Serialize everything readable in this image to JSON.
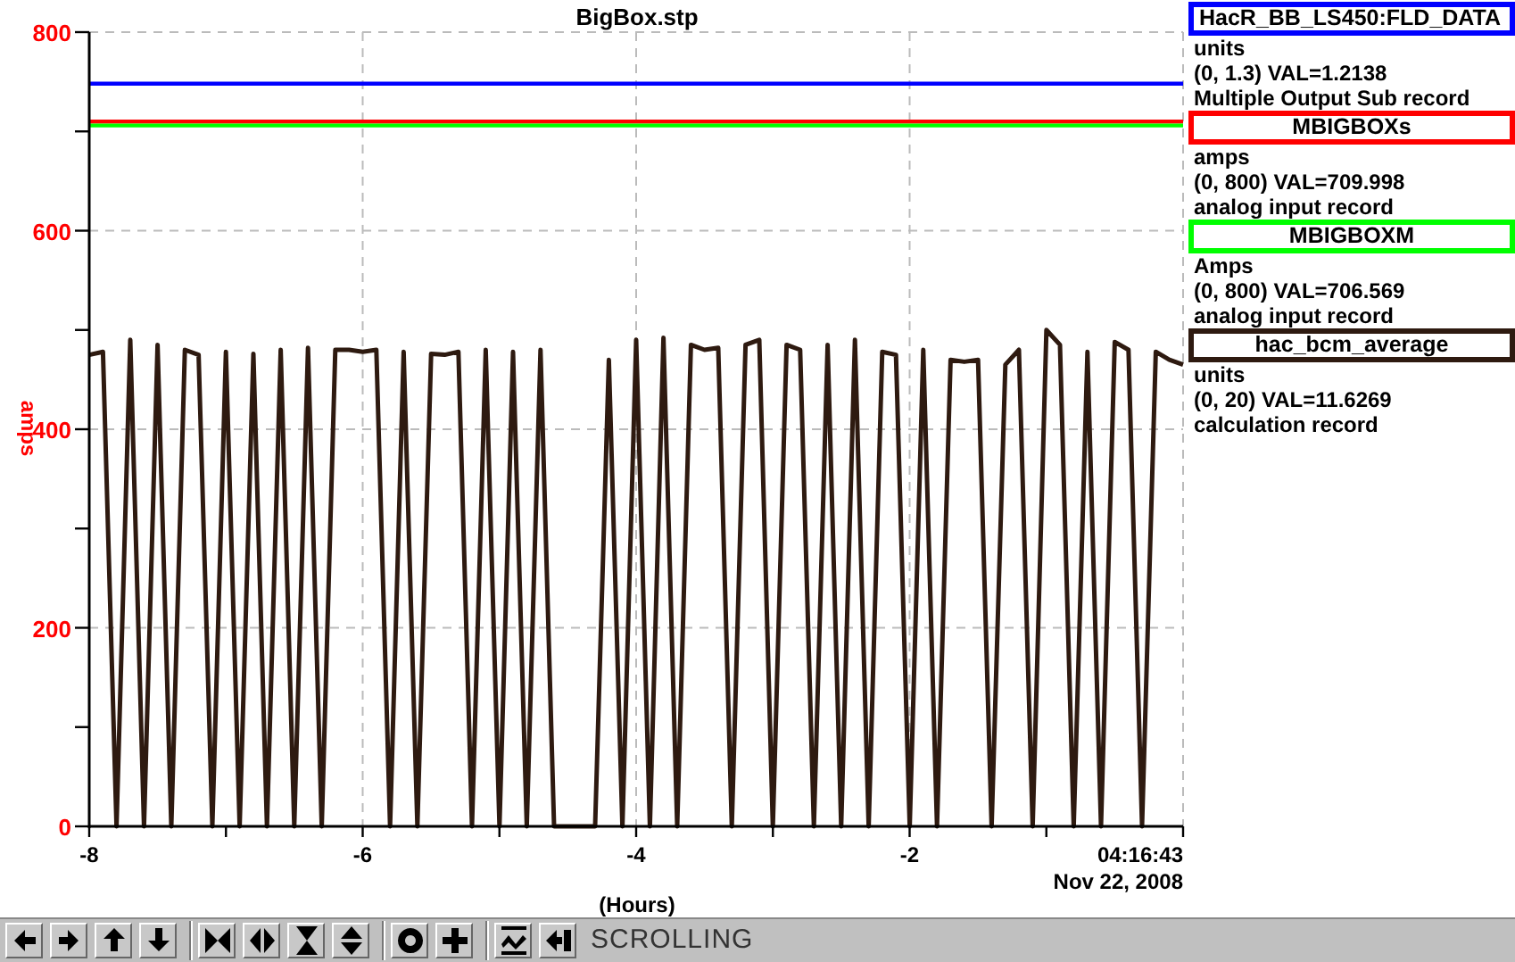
{
  "window": {
    "title": "BigBox.stp"
  },
  "chart": {
    "chart_data": {
      "type": "line",
      "grid": true,
      "xlabel": "(Hours)",
      "ylabel": "amps",
      "xlim": [
        -8,
        0
      ],
      "ylim": [
        0,
        800
      ],
      "xticks": [
        -8,
        -6,
        -4,
        -2
      ],
      "yticks": [
        0,
        200,
        400,
        600,
        800
      ],
      "x": [
        -8,
        -7.9,
        -7.8,
        -7.7,
        -7.6,
        -7.5,
        -7.4,
        -7.3,
        -7.2,
        -7.1,
        -7,
        -6.9,
        -6.8,
        -6.7,
        -6.6,
        -6.5,
        -6.4,
        -6.3,
        -6.2,
        -6.1,
        -6,
        -5.9,
        -5.8,
        -5.7,
        -5.6,
        -5.5,
        -5.4,
        -5.3,
        -5.2,
        -5.1,
        -5,
        -4.9,
        -4.8,
        -4.7,
        -4.6,
        -4.5,
        -4.4,
        -4.3,
        -4.2,
        -4.1,
        -4,
        -3.9,
        -3.8,
        -3.7,
        -3.6,
        -3.5,
        -3.4,
        -3.3,
        -3.2,
        -3.1,
        -3,
        -2.9,
        -2.8,
        -2.7,
        -2.6,
        -2.5,
        -2.4,
        -2.3,
        -2.2,
        -2.1,
        -2,
        -1.9,
        -1.8,
        -1.7,
        -1.6,
        -1.5,
        -1.4,
        -1.3,
        -1.2,
        -1.1,
        -1,
        -0.9,
        -0.8,
        -0.7,
        -0.6,
        -0.5,
        -0.4,
        -0.3,
        -0.2,
        -0.1,
        0
      ],
      "series": [
        {
          "name": "HacR_BB_LS450:FLD_DATA",
          "color": "#0000ff",
          "values": [
            748,
            748,
            748,
            748,
            748,
            748,
            748,
            748,
            748,
            748,
            748,
            748,
            748,
            748,
            748,
            748,
            748,
            748,
            748,
            748,
            748,
            748,
            748,
            748,
            748,
            748,
            748,
            748,
            748,
            748,
            748,
            748,
            748,
            748,
            748,
            748,
            748,
            748,
            748,
            748,
            748,
            748,
            748,
            748,
            748,
            748,
            748,
            748,
            748,
            748,
            748,
            748,
            748,
            748,
            748,
            748,
            748,
            748,
            748,
            748,
            748,
            748,
            748,
            748,
            748,
            748,
            748,
            748,
            748,
            748,
            748,
            748,
            748,
            748,
            748,
            748,
            748,
            748,
            748,
            748,
            748
          ]
        },
        {
          "name": "MBIGBOXs",
          "color": "#ff0000",
          "values": [
            710,
            710,
            710,
            710,
            710,
            710,
            710,
            710,
            710,
            710,
            710,
            710,
            710,
            710,
            710,
            710,
            710,
            710,
            710,
            710,
            710,
            710,
            710,
            710,
            710,
            710,
            710,
            710,
            710,
            710,
            710,
            710,
            710,
            710,
            710,
            710,
            710,
            710,
            710,
            710,
            710,
            710,
            710,
            710,
            710,
            710,
            710,
            710,
            710,
            710,
            710,
            710,
            710,
            710,
            710,
            710,
            710,
            710,
            710,
            710,
            710,
            710,
            710,
            710,
            710,
            710,
            710,
            710,
            710,
            710,
            710,
            710,
            710,
            710,
            710,
            710,
            710,
            710,
            710,
            710,
            710
          ]
        },
        {
          "name": "MBIGBOXM",
          "color": "#00ff00",
          "values": [
            706,
            706,
            706,
            706,
            706,
            706,
            706,
            706,
            706,
            706,
            706,
            706,
            706,
            706,
            706,
            706,
            706,
            706,
            706,
            706,
            706,
            706,
            706,
            706,
            706,
            706,
            706,
            706,
            706,
            706,
            706,
            706,
            706,
            706,
            706,
            706,
            706,
            706,
            706,
            706,
            706,
            706,
            706,
            706,
            706,
            706,
            706,
            706,
            706,
            706,
            706,
            706,
            706,
            706,
            706,
            706,
            706,
            706,
            706,
            706,
            706,
            706,
            706,
            706,
            706,
            706,
            706,
            706,
            706,
            706,
            706,
            706,
            706,
            706,
            706,
            706,
            706,
            706,
            706,
            706,
            706
          ]
        },
        {
          "name": "hac_bcm_average",
          "color": "#2e1a10",
          "values": [
            475,
            478,
            0,
            490,
            0,
            485,
            0,
            480,
            475,
            0,
            478,
            0,
            476,
            0,
            480,
            0,
            482,
            0,
            480,
            480,
            478,
            480,
            0,
            478,
            0,
            476,
            475,
            478,
            0,
            480,
            0,
            478,
            0,
            480,
            0,
            0,
            0,
            0,
            470,
            0,
            490,
            0,
            492,
            0,
            485,
            480,
            482,
            0,
            485,
            490,
            0,
            485,
            480,
            0,
            485,
            0,
            490,
            0,
            478,
            475,
            0,
            480,
            0,
            470,
            468,
            470,
            0,
            465,
            480,
            0,
            500,
            485,
            0,
            478,
            0,
            488,
            480,
            0,
            478,
            470,
            465
          ]
        }
      ]
    },
    "end_time": "04:16:43",
    "end_date": "Nov 22, 2008"
  },
  "legend": [
    {
      "units": "units",
      "range_value": "(0, 1.3) VAL=1.2138",
      "record_type": "Multiple Output Sub record"
    },
    {
      "units": "amps",
      "range_value": "(0, 800) VAL=709.998",
      "record_type": "analog input record"
    },
    {
      "units": "Amps",
      "range_value": "(0, 800) VAL=706.569",
      "record_type": "analog input record"
    },
    {
      "units": "units",
      "range_value": "(0, 20) VAL=11.6269",
      "record_type": "calculation record"
    }
  ],
  "toolbar": {
    "status": "SCROLLING"
  }
}
